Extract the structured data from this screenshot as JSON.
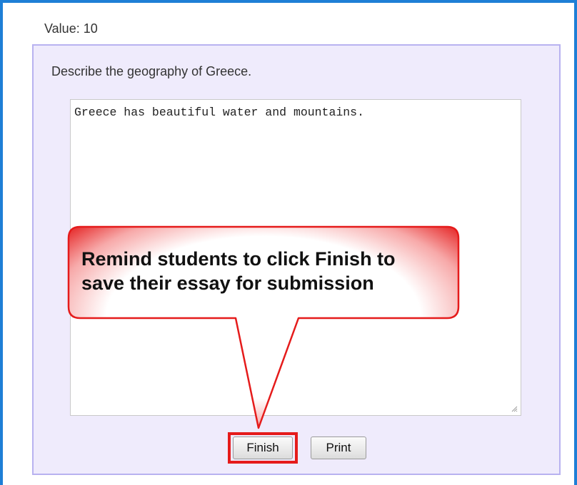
{
  "header": {
    "value_label": "Value: 10"
  },
  "question": {
    "prompt": "Describe the geography of Greece."
  },
  "essay": {
    "answer_text": "Greece has beautiful water and mountains."
  },
  "buttons": {
    "finish_label": "Finish",
    "print_label": "Print"
  },
  "callout": {
    "line1": "Remind students to click Finish to",
    "line2": "save their essay for submission"
  },
  "colors": {
    "frame_border": "#1e7fd6",
    "panel_background": "#efebfc",
    "panel_border": "#b8b2f0",
    "highlight_red": "#e51b1b"
  }
}
